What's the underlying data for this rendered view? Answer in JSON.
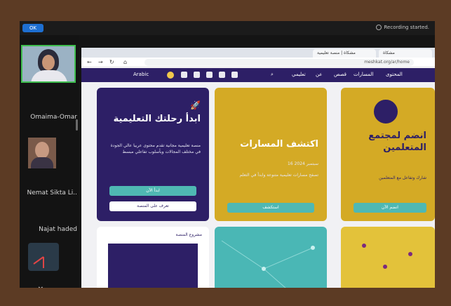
{
  "meeting": {
    "ok_label": "OK",
    "recording_text": "Recording started.",
    "participants": [
      {
        "name": "Omaima-Omar"
      },
      {
        "name": "Nemat Sikta Li.."
      },
      {
        "name": "Najat haded"
      }
    ]
  },
  "browser": {
    "tabs": [
      {
        "label": "مشكاة"
      },
      {
        "label": "مشكاة | منصة تعليمية"
      }
    ],
    "url": "meshkat.org/ar/home"
  },
  "site": {
    "nav": [
      "المحتوى",
      "المسارات",
      "قصص",
      "عن",
      "تعليمي",
      "Arabic"
    ],
    "cards": [
      {
        "title": "ابدأ رحلتك التعليمية",
        "body": "منصة تعليمية مجانية تقدم محتوى عربيا عالي الجودة في مختلف المجالات وبأسلوب تفاعلي مبسط",
        "primary": "ابدأ الآن",
        "secondary": "تعرف على المنصة"
      },
      {
        "title": "اكتشف المسارات",
        "date": "16 سبتمبر 2024",
        "body": "تصفح مسارات تعليمية متنوعة وابدأ في التعلم",
        "primary": "استكشف"
      },
      {
        "title": "انضم لمجتمع المتعلمين",
        "body": "شارك وتفاعل مع المتعلمين",
        "primary": "انضم الآن"
      }
    ],
    "second_row_label": "مشروع المنصة"
  }
}
